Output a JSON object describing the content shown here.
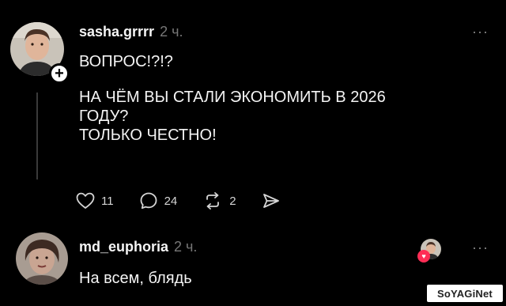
{
  "post": {
    "username": "sasha.grrrr",
    "time": "2 ч.",
    "text_line1": "ВОПРОС!?!?",
    "text_line2": "НА ЧЁМ ВЫ СТАЛИ ЭКОНОМИТЬ В 2026",
    "text_line3": "ГОДУ?",
    "text_line4": "ТОЛЬКО ЧЕСТНО!",
    "follow_symbol": "+",
    "more_symbol": "···",
    "likes": "11",
    "comments": "24",
    "reposts": "2"
  },
  "reply": {
    "username": "md_euphoria",
    "time": "2 ч.",
    "text": "На всем, блядь",
    "more_symbol": "···"
  },
  "icons": {
    "like": "heart-outline-icon",
    "comment": "speech-bubble-icon",
    "repost": "repost-icon",
    "share": "send-icon",
    "liked_by_author": "heart-badge-icon"
  },
  "watermark": "SoYAGiNet",
  "colors": {
    "background": "#000000",
    "text": "#f3f3f3",
    "muted": "#777777",
    "like_badge": "#ff2d55"
  }
}
